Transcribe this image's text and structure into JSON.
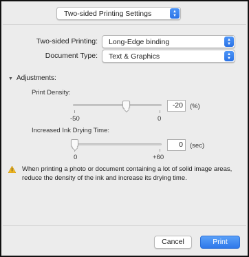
{
  "settings_popup": {
    "value": "Two-sided Printing Settings"
  },
  "two_sided_printing": {
    "label": "Two-sided Printing:",
    "value": "Long-Edge binding"
  },
  "document_type": {
    "label": "Document Type:",
    "value": "Text & Graphics"
  },
  "adjustments": {
    "header": "Adjustments:",
    "print_density": {
      "label": "Print Density:",
      "min_label": "-50",
      "max_label": "0",
      "min": -50,
      "max": 0,
      "value": "-20",
      "unit": "(%)"
    },
    "drying_time": {
      "label": "Increased Ink Drying Time:",
      "min_label": "0",
      "max_label": "+60",
      "min": 0,
      "max": 60,
      "value": "0",
      "unit": "(sec)"
    }
  },
  "warning": {
    "icon": "warning-icon",
    "text": "When printing a photo or document containing a lot of solid image areas, reduce the density of the ink and increase its drying time."
  },
  "buttons": {
    "cancel": "Cancel",
    "print": "Print"
  },
  "colors": {
    "accent": "#2e78ea",
    "warning": "#f2b822"
  }
}
